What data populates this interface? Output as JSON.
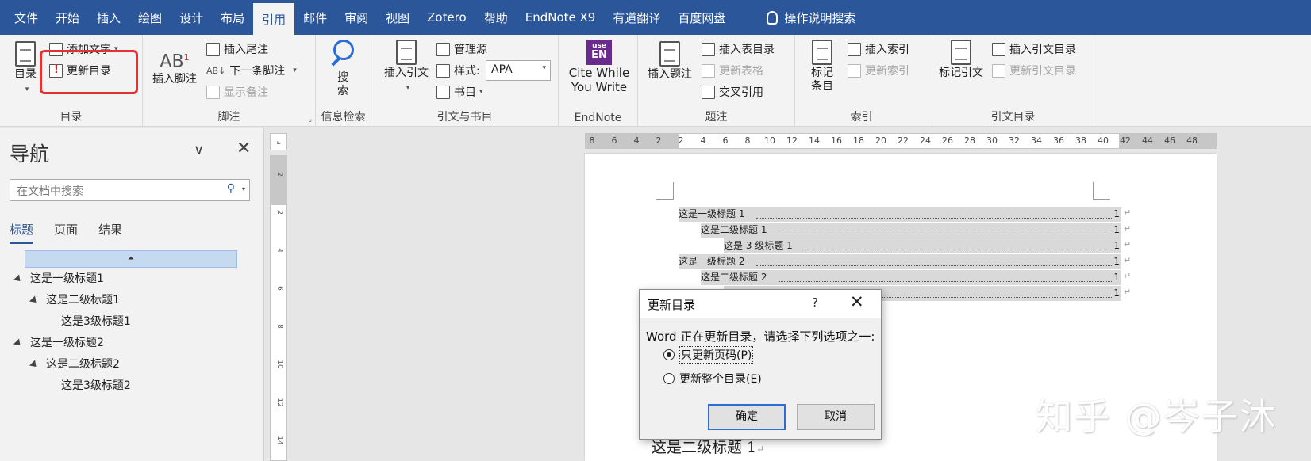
{
  "ribbon_tabs": [
    "文件",
    "开始",
    "插入",
    "绘图",
    "设计",
    "布局",
    "引用",
    "邮件",
    "审阅",
    "视图",
    "Zotero",
    "帮助",
    "EndNote X9",
    "有道翻译",
    "百度网盘"
  ],
  "active_tab": "引用",
  "tell_me": "操作说明搜索",
  "groups": {
    "toc": {
      "label": "目录",
      "toc_button": "目录",
      "add_text": "添加文字",
      "update_toc": "更新目录"
    },
    "footnotes": {
      "label": "脚注",
      "insert_footnote": "插入脚注",
      "insert_endnote": "插入尾注",
      "next_footnote": "下一条脚注",
      "show_notes": "显示备注"
    },
    "research": {
      "label": "信息检索",
      "search": "搜索"
    },
    "citations": {
      "label": "引文与书目",
      "insert_citation": "插入引文",
      "manage_sources": "管理源",
      "style_label": "样式:",
      "style_value": "APA",
      "bibliography": "书目"
    },
    "endnote": {
      "label": "EndNote",
      "cwyw_line1": "Cite While",
      "cwyw_line2": "You Write",
      "logo_top": "use",
      "logo_bottom": "EN"
    },
    "captions": {
      "label": "题注",
      "insert_caption": "插入题注",
      "insert_table_of_figures": "插入表目录",
      "update_table": "更新表格",
      "cross_reference": "交叉引用"
    },
    "index": {
      "label": "索引",
      "mark_entry_line1": "标记",
      "mark_entry_line2": "条目",
      "insert_index": "插入索引",
      "update_index": "更新索引"
    },
    "toa": {
      "label": "引文目录",
      "mark_citation": "标记引文",
      "insert_toa": "插入引文目录",
      "update_toa": "更新引文目录"
    }
  },
  "nav": {
    "title": "导航",
    "search_placeholder": "在文档中搜索",
    "tabs": [
      "标题",
      "页面",
      "结果"
    ],
    "active_tab": "标题",
    "headings": [
      {
        "text": "这是一级标题1",
        "level": 1
      },
      {
        "text": "这是二级标题1",
        "level": 2
      },
      {
        "text": "这是3级标题1",
        "level": 3
      },
      {
        "text": "这是一级标题2",
        "level": 1
      },
      {
        "text": "这是二级标题2",
        "level": 2
      },
      {
        "text": "这是3级标题2",
        "level": 3
      }
    ]
  },
  "hruler_numbers": [
    "8",
    "6",
    "4",
    "2",
    "2",
    "4",
    "6",
    "8",
    "10",
    "12",
    "14",
    "16",
    "18",
    "20",
    "22",
    "24",
    "26",
    "28",
    "30",
    "32",
    "34",
    "36",
    "38",
    "40",
    "42",
    "44",
    "46",
    "48"
  ],
  "vruler_numbers": [
    "2",
    "2",
    "4",
    "6",
    "8",
    "10",
    "12",
    "14"
  ],
  "document": {
    "toc_entries": [
      {
        "text": "这是一级标题 1",
        "page": "1",
        "level": 1
      },
      {
        "text": "这是二级标题 1",
        "page": "1",
        "level": 2
      },
      {
        "text": "这是 3 级标题 1",
        "page": "1",
        "level": 3
      },
      {
        "text": "这是一级标题 2",
        "page": "1",
        "level": 1
      },
      {
        "text": "这是二级标题 2",
        "page": "1",
        "level": 2
      },
      {
        "text": "",
        "page": "1",
        "level": 3
      }
    ],
    "paragraph_mark": "↵",
    "heading_visible": "这是二级标题 1"
  },
  "dialog": {
    "title": "更新目录",
    "help": "?",
    "prompt": "Word 正在更新目录，请选择下列选项之一:",
    "option1": "只更新页码(P)",
    "option2": "更新整个目录(E)",
    "selected": "option1",
    "ok": "确定",
    "cancel": "取消"
  },
  "watermark": "知乎 @岑子沐",
  "colors": {
    "accent": "#2b579a",
    "highlight_box": "#e23333",
    "toc_field_shade": "#d9d9d9"
  }
}
